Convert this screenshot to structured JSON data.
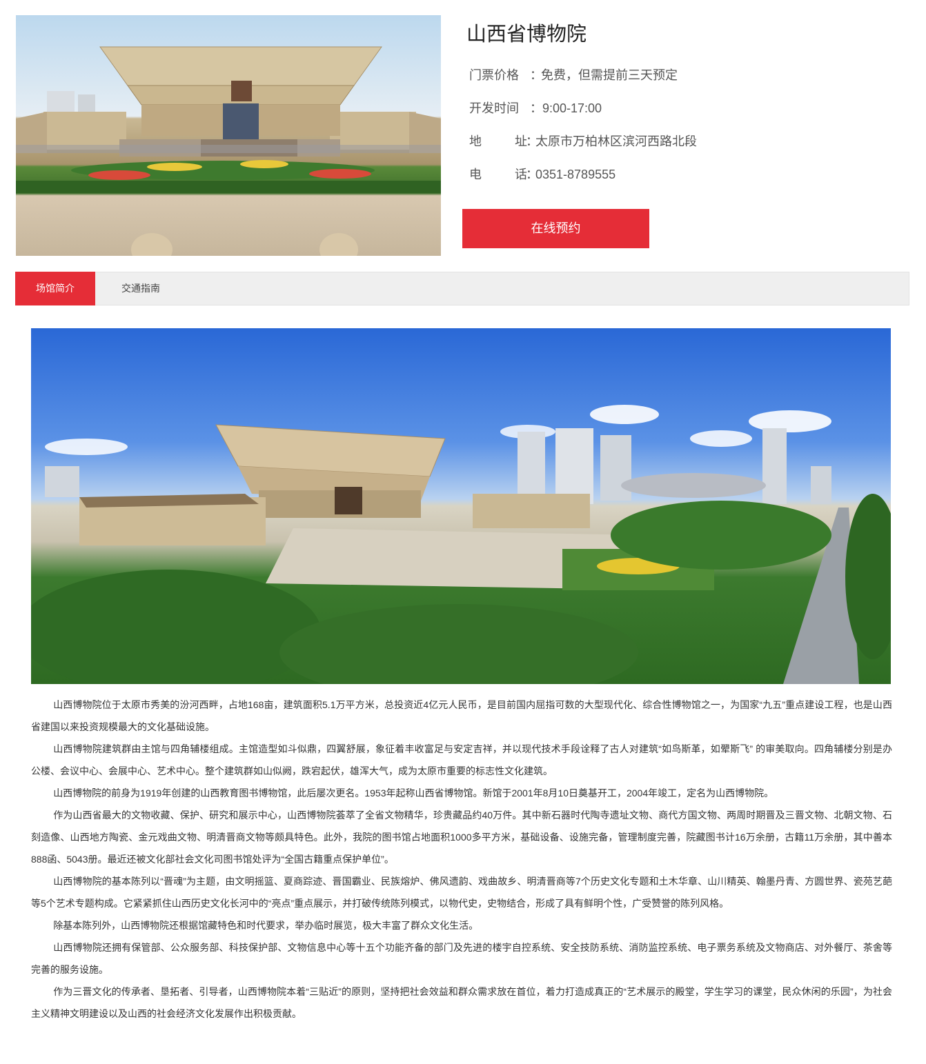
{
  "venue": {
    "title": "山西省博物院",
    "ticket": {
      "label": "门票价格",
      "colon": "：",
      "value": "免费，但需提前三天预定"
    },
    "hours": {
      "label": "开发时间",
      "colon": "：",
      "value": "9:00-17:00"
    },
    "address": {
      "label_a": "地",
      "label_b": "址",
      "colon": "：",
      "value": "太原市万柏林区滨河西路北段"
    },
    "phone": {
      "label_a": "电",
      "label_b": "话",
      "colon": "：",
      "value": "0351-8789555"
    },
    "book_button": "在线预约"
  },
  "tabs": [
    {
      "label": "场馆简介",
      "active": true
    },
    {
      "label": "交通指南",
      "active": false
    }
  ],
  "colors": {
    "accent": "#e52d37",
    "tab_bg": "#efefef"
  },
  "article": [
    "山西博物院位于太原市秀美的汾河西畔，占地168亩，建筑面积5.1万平方米，总投资近4亿元人民币，是目前国内屈指可数的大型现代化、综合性博物馆之一，为国家“九五”重点建设工程，也是山西省建国以来投资规模最大的文化基础设施。",
    "山西博物院建筑群由主馆与四角辅楼组成。主馆造型如斗似鼎，四翼舒展，象征着丰收富足与安定吉祥，并以现代技术手段诠释了古人对建筑“如鸟斯革，如翚斯飞” 的审美取向。四角辅楼分别是办公楼、会议中心、会展中心、艺术中心。整个建筑群如山似阙，跌宕起伏，雄浑大气，成为太原市重要的标志性文化建筑。",
    "山西博物院的前身为1919年创建的山西教育图书博物馆，此后屡次更名。1953年起称山西省博物馆。新馆于2001年8月10日奠基开工，2004年竣工，定名为山西博物院。",
    "作为山西省最大的文物收藏、保护、研究和展示中心，山西博物院荟萃了全省文物精华，珍贵藏品约40万件。其中新石器时代陶寺遗址文物、商代方国文物、两周时期晋及三晋文物、北朝文物、石刻造像、山西地方陶瓷、金元戏曲文物、明清晋商文物等颇具特色。此外，我院的图书馆占地面积1000多平方米，基础设备、设施完备，管理制度完善，院藏图书计16万余册，古籍11万余册，其中善本888函、5043册。最近还被文化部社会文化司图书馆处评为“全国古籍重点保护单位”。",
    "山西博物院的基本陈列以“晋魂”为主题，由文明摇篮、夏商踪迹、晋国霸业、民族熔炉、佛风遗韵、戏曲故乡、明清晋商等7个历史文化专题和土木华章、山川精英、翰墨丹青、方圆世界、瓷苑艺葩等5个艺术专题构成。它紧紧抓住山西历史文化长河中的“亮点”重点展示，并打破传统陈列模式，以物代史，史物结合，形成了具有鲜明个性，广受赞誉的陈列风格。",
    "除基本陈列外，山西博物院还根据馆藏特色和时代要求，举办临时展览，极大丰富了群众文化生活。",
    "山西博物院还拥有保管部、公众服务部、科技保护部、文物信息中心等十五个功能齐备的部门及先进的楼宇自控系统、安全技防系统、消防监控系统、电子票务系统及文物商店、对外餐厅、茶舍等完善的服务设施。",
    "作为三晋文化的传承者、垦拓者、引导者，山西博物院本着“三贴近”的原则，坚持把社会效益和群众需求放在首位，着力打造成真正的“艺术展示的殿堂，学生学习的课堂，民众休闲的乐园”，为社会主义精神文明建设以及山西的社会经济文化发展作出积极贡献。"
  ]
}
